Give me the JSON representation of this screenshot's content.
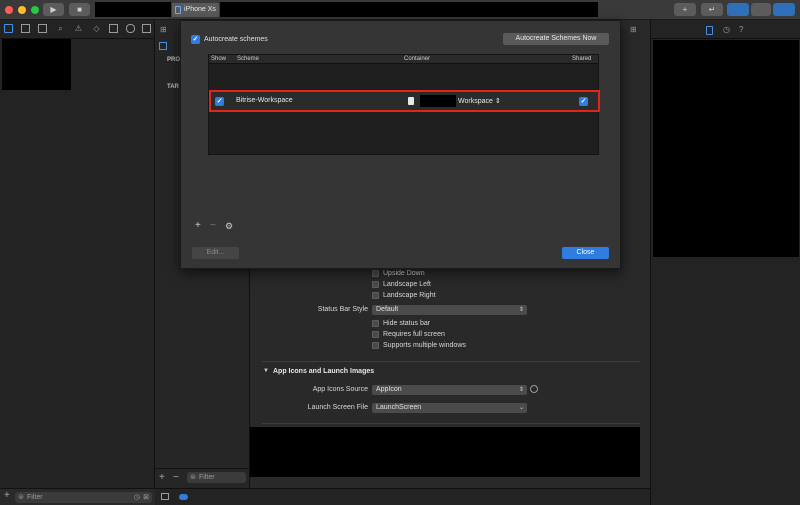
{
  "toolbar": {
    "scheme_target": "iPhone Xs",
    "run_symbol": "▶",
    "stop_symbol": "■",
    "add_symbol": "+",
    "history_symbol": "↵"
  },
  "navigator": {
    "filter_placeholder": "Filter"
  },
  "middle": {
    "section_project": "PRO",
    "section_targets": "TAR",
    "filter_placeholder": "Filter",
    "add_symbol": "+",
    "remove_symbol": "−"
  },
  "editor": {
    "orientation_options": [
      {
        "label": "Upside Down",
        "checked": false
      },
      {
        "label": "Landscape Left",
        "checked": false
      },
      {
        "label": "Landscape Right",
        "checked": false
      }
    ],
    "status_bar_style_label": "Status Bar Style",
    "status_bar_style_value": "Default",
    "status_options": [
      {
        "label": "Hide status bar",
        "checked": false
      },
      {
        "label": "Requires full screen",
        "checked": false
      },
      {
        "label": "Supports multiple windows",
        "checked": false
      }
    ],
    "app_icons_section": "App Icons and Launch Images",
    "app_icons_source_label": "App Icons Source",
    "app_icons_source_value": "AppIcon",
    "launch_screen_label": "Launch Screen File",
    "launch_screen_value": "LaunchScreen"
  },
  "sheet": {
    "autocreate_label": "Autocreate schemes",
    "autocreate_checked": true,
    "autocreate_now_button": "Autocreate Schemes Now",
    "columns": [
      "Show",
      "Scheme",
      "Container",
      "Shared"
    ],
    "rows": [
      {
        "show": true,
        "scheme": "Bitrise-Workspace",
        "container": "Workspace",
        "shared": true
      }
    ],
    "edit_button": "Edit...",
    "close_button": "Close",
    "add_symbol": "+",
    "remove_symbol": "−",
    "gear_symbol": "⚙",
    "highlight_color": "#e0261b"
  },
  "colors": {
    "accent": "#2f7de1",
    "window_bg": "#292929"
  }
}
